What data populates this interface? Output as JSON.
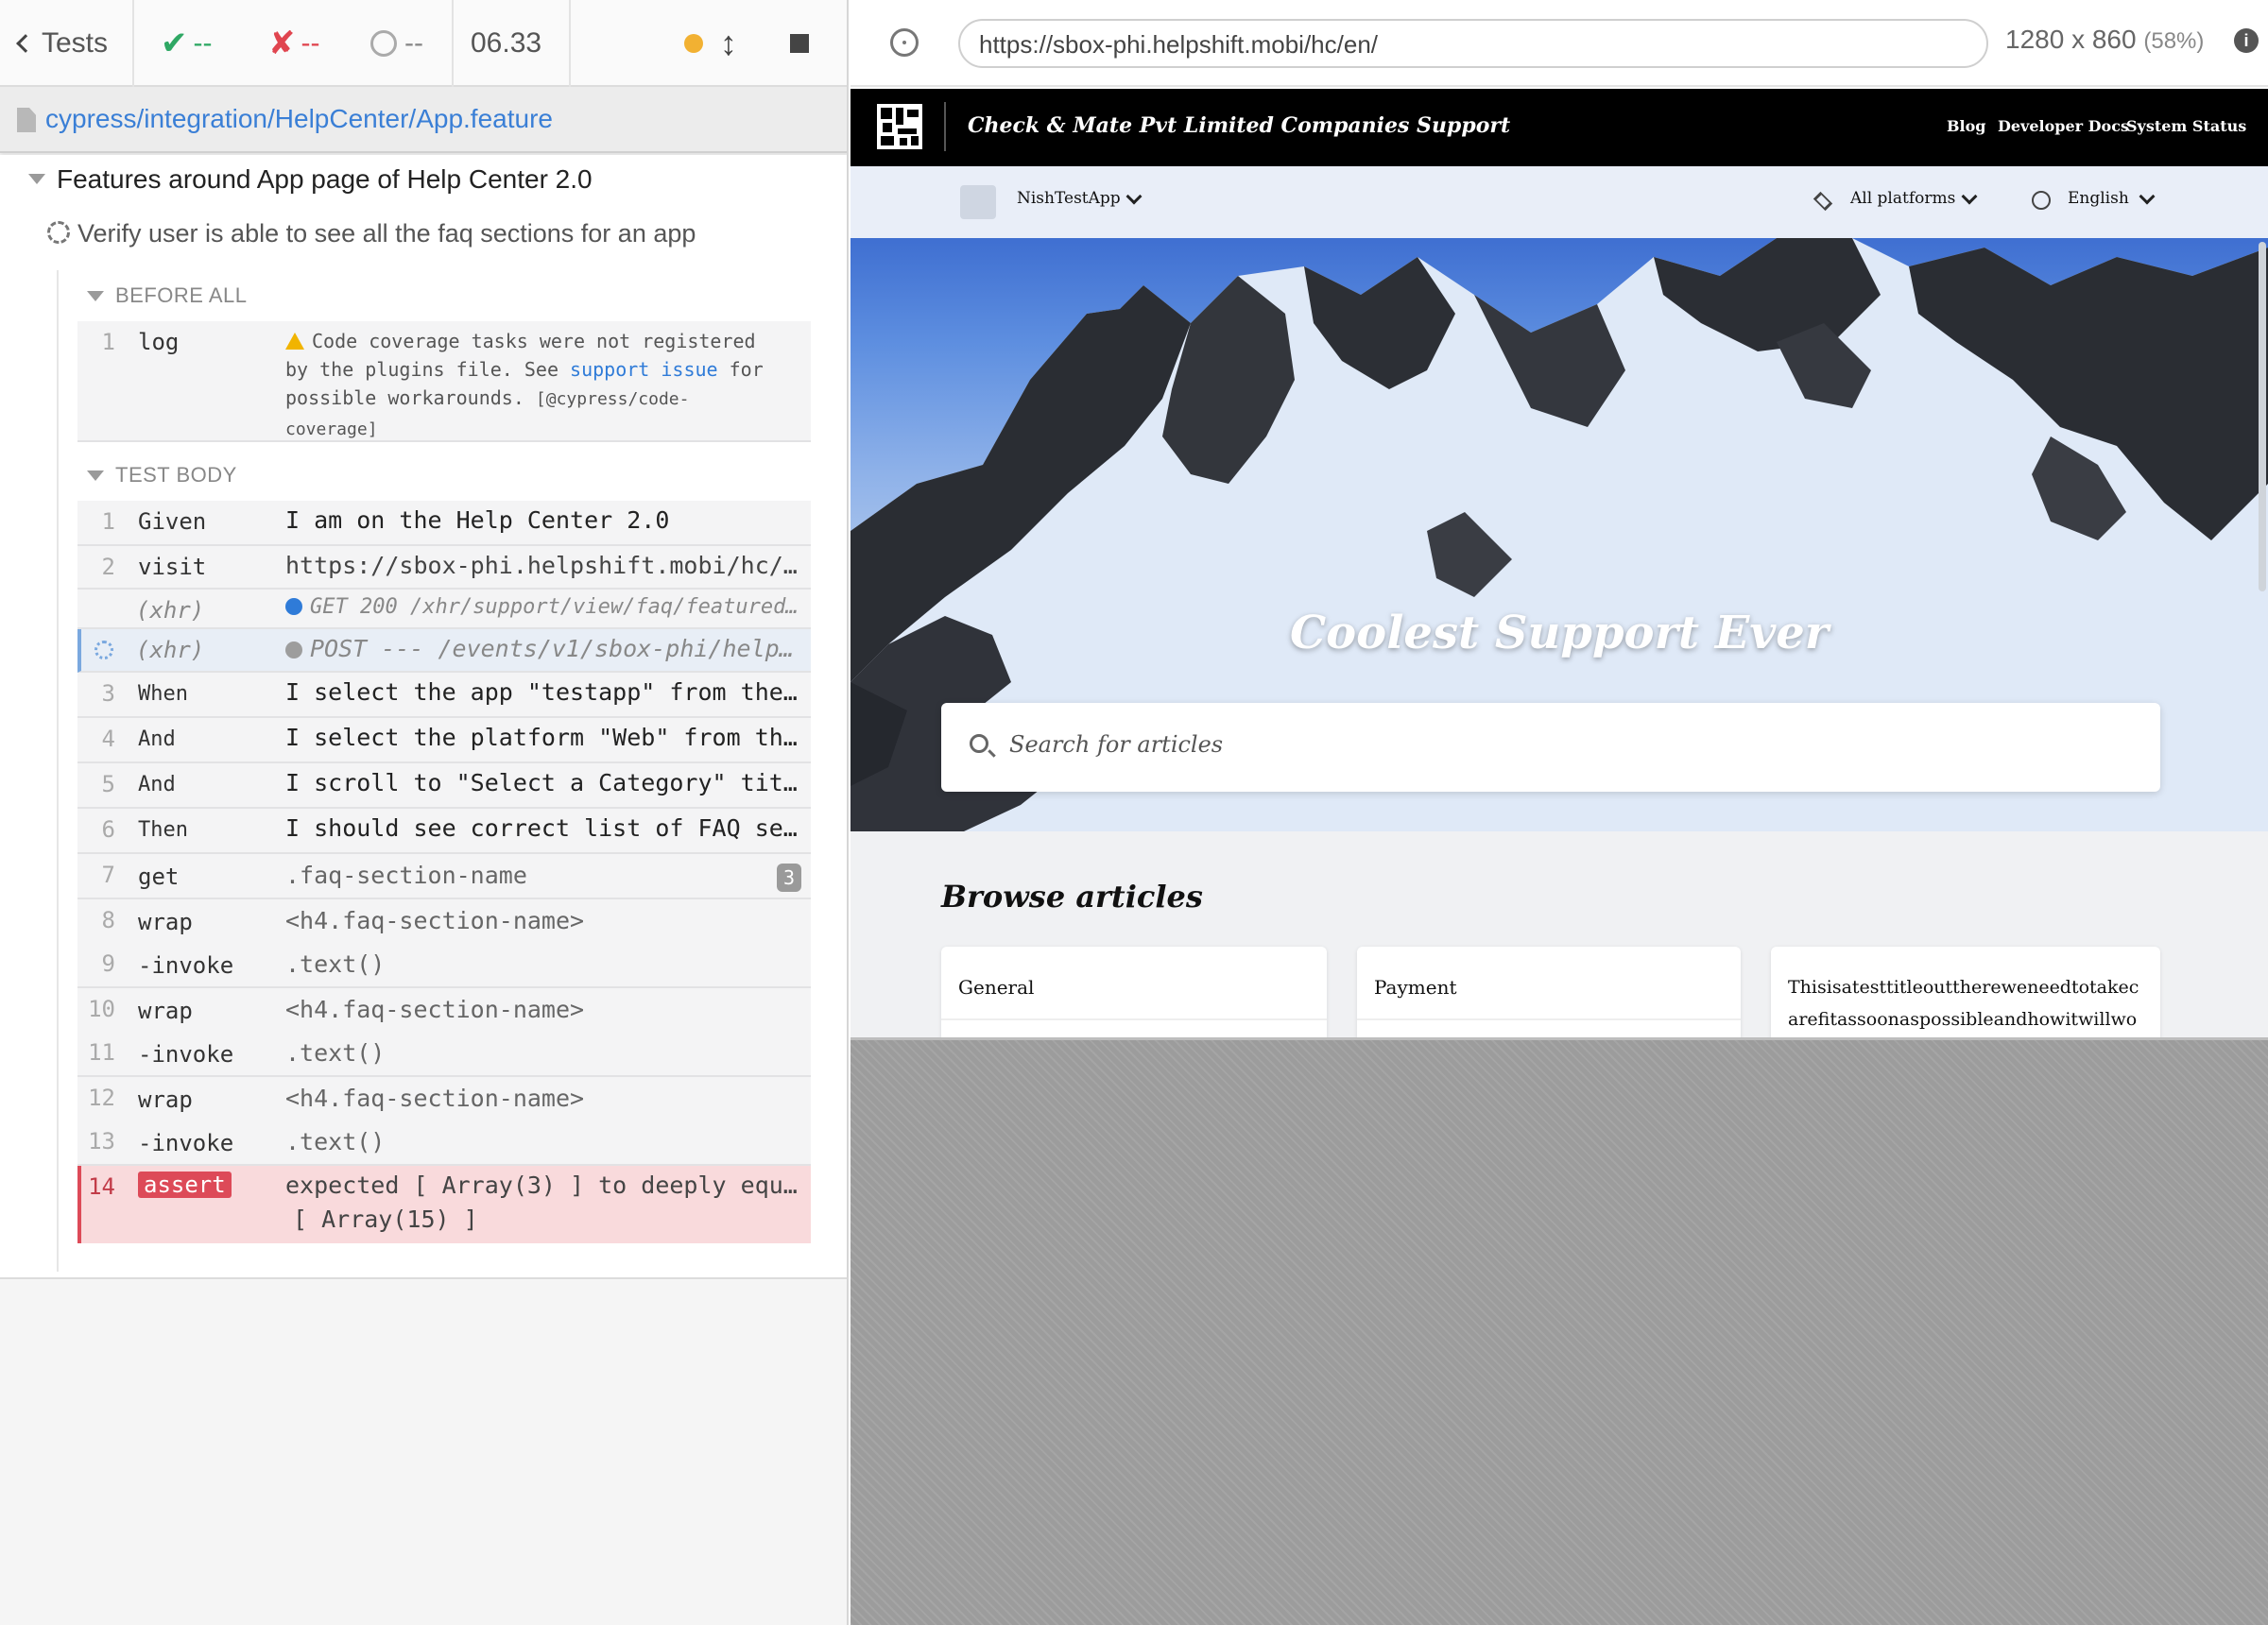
{
  "reporter": {
    "tests_label": "Tests",
    "passed": "--",
    "failed": "--",
    "pending": "--",
    "duration": "06.33",
    "spec_path": "cypress/integration/HelpCenter/App.feature",
    "suite_title": "Features around App page of Help Center 2.0",
    "test_title": "Verify user is able to see all the faq sections for an app",
    "before_all_label": "BEFORE ALL",
    "test_body_label": "TEST BODY",
    "before_all_command": {
      "num": "1",
      "name": "log",
      "msg_part1": "Code coverage tasks were not registered by the plugins file. See",
      "link1": "support",
      "link2": "issue",
      "msg_part2": "for possible workarounds.",
      "msg_part3": "[@cypress/code-coverage]"
    },
    "commands": [
      {
        "num": "1",
        "name": "Given",
        "msg": "I am on the Help Center 2.0"
      },
      {
        "num": "2",
        "name": "visit",
        "msg": "https://sbox-phi.helpshift.mobi/hc/e…"
      },
      {
        "num": "",
        "name": "(xhr)",
        "msg": "GET 200 /xhr/support/view/faq/featured/?a…"
      },
      {
        "num": "",
        "name": "(xhr)",
        "msg": "POST --- /events/v1/sbox-phi/help-…"
      },
      {
        "num": "3",
        "name": "When",
        "msg": "I select the app \"testapp\" from the …"
      },
      {
        "num": "4",
        "name": "And",
        "msg": "I select the platform \"Web\" from the…"
      },
      {
        "num": "5",
        "name": "And",
        "msg": "I scroll to \"Select a Category\" title"
      },
      {
        "num": "6",
        "name": "Then",
        "msg": "I should see correct list of FAQ sec…"
      },
      {
        "num": "7",
        "name": "get",
        "msg": ".faq-section-name",
        "count": "3"
      },
      {
        "num": "8",
        "name": "wrap",
        "msg": "<h4.faq-section-name>"
      },
      {
        "num": "9",
        "name": "-invoke",
        "msg": ".text()"
      },
      {
        "num": "10",
        "name": "wrap",
        "msg": "<h4.faq-section-name>"
      },
      {
        "num": "11",
        "name": "-invoke",
        "msg": ".text()"
      },
      {
        "num": "12",
        "name": "wrap",
        "msg": "<h4.faq-section-name>"
      },
      {
        "num": "13",
        "name": "-invoke",
        "msg": ".text()"
      },
      {
        "num": "14",
        "name": "assert",
        "msg_line1": "expected [ Array(3) ] to deeply equal",
        "msg_line2": "[ Array(15) ]"
      }
    ]
  },
  "aut": {
    "url": "https://sbox-phi.helpshift.mobi/hc/en/",
    "viewport": "1280 x 860",
    "scale": "(58%)",
    "info_icon": "i",
    "company": "Check & Mate Pvt Limited Companies Support",
    "nav_links": [
      "Blog",
      "Developer Docs",
      "System Status"
    ],
    "app_selector": "NishTestApp",
    "platform_selector": "All platforms",
    "language_selector": "English",
    "hero_title": "Coolest Support Ever",
    "search_placeholder": "Search for articles",
    "browse_title": "Browse articles",
    "cards": [
      "General",
      "Payment",
      "Thisisatesttitleoutthereweneedtotakecarefitassoonaspossibleandhowitwillwork!"
    ]
  },
  "colors": {
    "passed": "#2fa864",
    "failed": "#e0454f",
    "link": "#2f7bd8",
    "running_dot": "#f2b132",
    "xhr_get_dot": "#2f7bd8",
    "xhr_pending_dot": "#9d9d9d"
  }
}
